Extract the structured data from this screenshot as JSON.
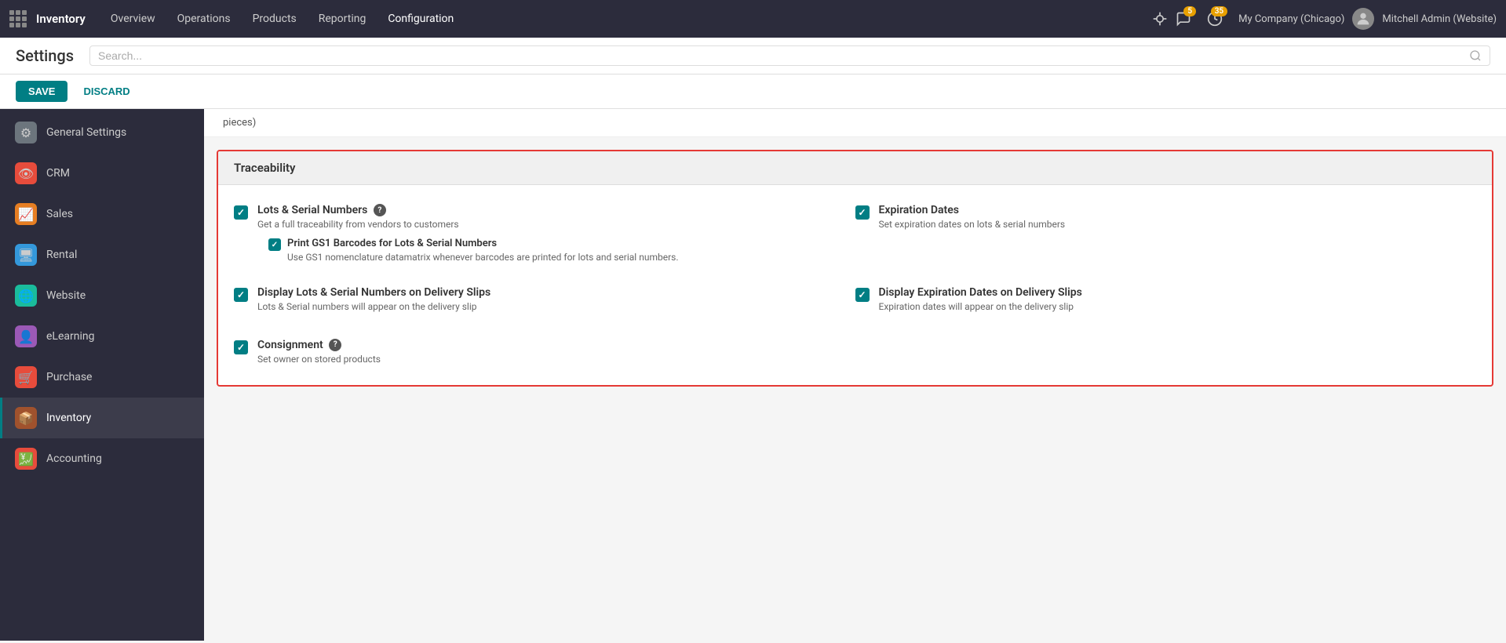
{
  "topnav": {
    "brand": "Inventory",
    "nav_items": [
      "Overview",
      "Operations",
      "Products",
      "Reporting",
      "Configuration"
    ],
    "active_nav": "Configuration",
    "bug_count": "",
    "chat_count": "5",
    "clock_count": "35",
    "company": "My Company (Chicago)",
    "user": "Mitchell Admin (Website)"
  },
  "subheader": {
    "title": "Settings",
    "search_placeholder": "Search..."
  },
  "buttons": {
    "save": "SAVE",
    "discard": "DISCARD"
  },
  "sidebar": {
    "items": [
      {
        "id": "general-settings",
        "label": "General Settings",
        "icon": "⚙",
        "iconClass": "si-general",
        "active": false
      },
      {
        "id": "crm",
        "label": "CRM",
        "icon": "👁",
        "iconClass": "si-crm",
        "active": false
      },
      {
        "id": "sales",
        "label": "Sales",
        "icon": "📈",
        "iconClass": "si-sales",
        "active": false
      },
      {
        "id": "rental",
        "label": "Rental",
        "icon": "🖥",
        "iconClass": "si-rental",
        "active": false
      },
      {
        "id": "website",
        "label": "Website",
        "icon": "🌐",
        "iconClass": "si-website",
        "active": false
      },
      {
        "id": "elearning",
        "label": "eLearning",
        "icon": "👤",
        "iconClass": "si-elearning",
        "active": false
      },
      {
        "id": "purchase",
        "label": "Purchase",
        "icon": "🛒",
        "iconClass": "si-purchase",
        "active": false
      },
      {
        "id": "inventory",
        "label": "Inventory",
        "icon": "📦",
        "iconClass": "si-inventory",
        "active": true
      },
      {
        "id": "accounting",
        "label": "Accounting",
        "icon": "💹",
        "iconClass": "si-accounting",
        "active": false
      }
    ]
  },
  "content": {
    "pieces_text": "pieces)",
    "traceability": {
      "header": "Traceability",
      "settings": [
        {
          "id": "lots-serial",
          "checked": true,
          "title": "Lots & Serial Numbers",
          "has_help": true,
          "description": "Get a full traceability from vendors to customers",
          "sub_settings": [
            {
              "id": "print-gs1",
              "checked": true,
              "title": "Print GS1 Barcodes for Lots & Serial Numbers",
              "description": "Use GS1 nomenclature datamatrix whenever barcodes are printed for lots and serial numbers."
            }
          ],
          "right_partner": {
            "id": "expiration-dates",
            "checked": true,
            "title": "Expiration Dates",
            "has_help": false,
            "description": "Set expiration dates on lots & serial numbers"
          }
        },
        {
          "id": "display-lots",
          "checked": true,
          "title": "Display Lots & Serial Numbers on Delivery Slips",
          "has_help": false,
          "description": "Lots & Serial numbers will appear on the delivery slip",
          "right_partner": {
            "id": "display-expiration",
            "checked": true,
            "title": "Display Expiration Dates on Delivery Slips",
            "has_help": false,
            "description": "Expiration dates will appear on the delivery slip"
          }
        },
        {
          "id": "consignment",
          "checked": true,
          "title": "Consignment",
          "has_help": true,
          "description": "Set owner on stored products"
        }
      ]
    }
  }
}
